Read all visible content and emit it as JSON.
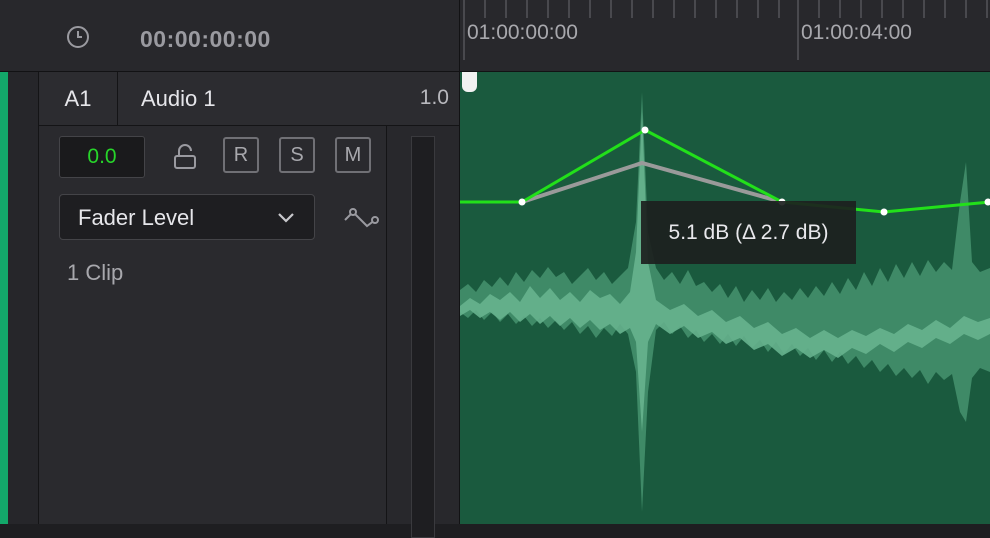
{
  "header": {
    "timecode": "00:00:00:00",
    "clock_icon": "clock-icon"
  },
  "ruler": {
    "labels": [
      "01:00:00:00",
      "01:00:04:00"
    ]
  },
  "track": {
    "id": "A1",
    "name": "Audio 1",
    "ratio": "1.0",
    "volume": "0.0",
    "buttons": [
      "R",
      "S",
      "M"
    ],
    "automation_param": "Fader Level",
    "clip_count": "1 Clip",
    "color": "#13a86a"
  },
  "clip": {
    "tooltip": "5.1 dB (Δ 2.7 dB)",
    "automation_color": "#22e01a",
    "waveform_color": "#5fa987"
  }
}
